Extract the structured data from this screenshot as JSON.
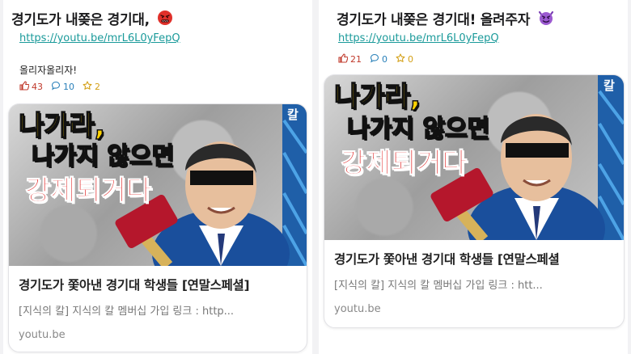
{
  "posts": [
    {
      "title": "경기도가 내쫒은 경기대,",
      "title_emoji": "angry-face-with-symbols-emoji",
      "link": "https://youtu.be/mrL6L0yFepQ",
      "body": "올리자올리자!",
      "stats": {
        "likes": "43",
        "comments": "10",
        "favorites": "2"
      },
      "card": {
        "thumb_text_line1": "나가라,",
        "thumb_text_line2": "나가지 않으면",
        "thumb_text_line3": "강제퇴거다",
        "channel_mark": "칼",
        "title": "경기도가 쫓아낸 경기대 학생들 [연말스페셜]",
        "description": "[지식의 칼]  지식의 칼 멤버십 가입 링크 : http...",
        "domain": "youtu.be"
      }
    },
    {
      "title": "경기도가 내쫒은 경기대! 올려주자",
      "title_emoji": "smiling-face-with-horns-emoji",
      "link": "https://youtu.be/mrL6L0yFepQ",
      "stats": {
        "likes": "21",
        "comments": "0",
        "favorites": "0"
      },
      "card": {
        "thumb_text_line1": "나가라,",
        "thumb_text_line2": "나가지 않으면",
        "thumb_text_line3": "강제퇴거다",
        "channel_mark": "칼",
        "title": "경기도가 쫓아낸 경기대 학생들 [연말스페셜",
        "description": "[지식의 칼]  지식의 칼 멤버십 가입 링크 : htt...",
        "domain": "youtu.be"
      }
    }
  ],
  "colors": {
    "link": "#1a9a9a",
    "like": "#c0392b",
    "comment": "#2980b9",
    "favorite": "#d4a017",
    "thumb_yellow": "#ffd200",
    "thumb_red": "#e02020"
  }
}
